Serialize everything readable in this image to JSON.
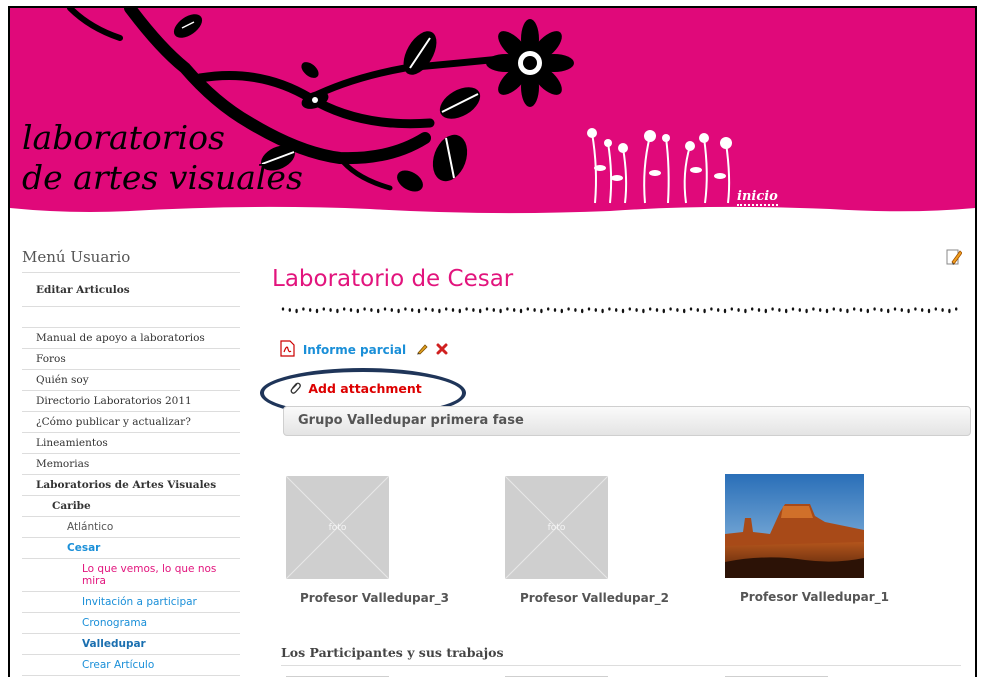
{
  "banner": {
    "logo_line1": "laboratorios",
    "logo_line2": "de artes visuales",
    "inicio_label": "inicio",
    "bg_color": "#e0097a"
  },
  "sidebar": {
    "title": "Menú Usuario",
    "items": [
      {
        "label": "Editar Articulos"
      },
      {
        "label": "Manual de apoyo a laboratorios"
      },
      {
        "label": "Foros"
      },
      {
        "label": "Quién soy"
      },
      {
        "label": "Directorio Laboratorios 2011"
      },
      {
        "label": "¿Cómo publicar y actualizar?"
      },
      {
        "label": "Lineamientos"
      },
      {
        "label": "Memorias"
      },
      {
        "label": "Laboratorios de Artes Visuales"
      },
      {
        "label": "Caribe"
      },
      {
        "label": "Atlántico"
      },
      {
        "label": "Cesar"
      },
      {
        "label": "Lo que vemos, lo que nos mira"
      },
      {
        "label": "Invitación a participar"
      },
      {
        "label": "Cronograma"
      },
      {
        "label": "Valledupar"
      },
      {
        "label": "Crear Artículo"
      }
    ]
  },
  "main": {
    "title": "Laboratorio de Cesar",
    "attachment_link": "Informe parcial",
    "add_attachment": "Add attachment",
    "group_title": "Grupo Valledupar primera fase",
    "photos": [
      {
        "caption": "Profesor Valledupar_3",
        "placeholder": "foto"
      },
      {
        "caption": "Profesor Valledupar_2",
        "placeholder": "foto"
      },
      {
        "caption": "Profesor Valledupar_1",
        "placeholder": ""
      }
    ],
    "section_heading": "Los Participantes y sus trabajos"
  },
  "colors": {
    "accent_pink": "#e2147d",
    "link_blue": "#1a8fd8",
    "alert_red": "#dd0000",
    "highlight_navy": "#1f3559"
  },
  "icons": [
    "pdf-icon",
    "pencil-icon",
    "delete-icon",
    "paperclip-icon",
    "edit-page-icon"
  ]
}
